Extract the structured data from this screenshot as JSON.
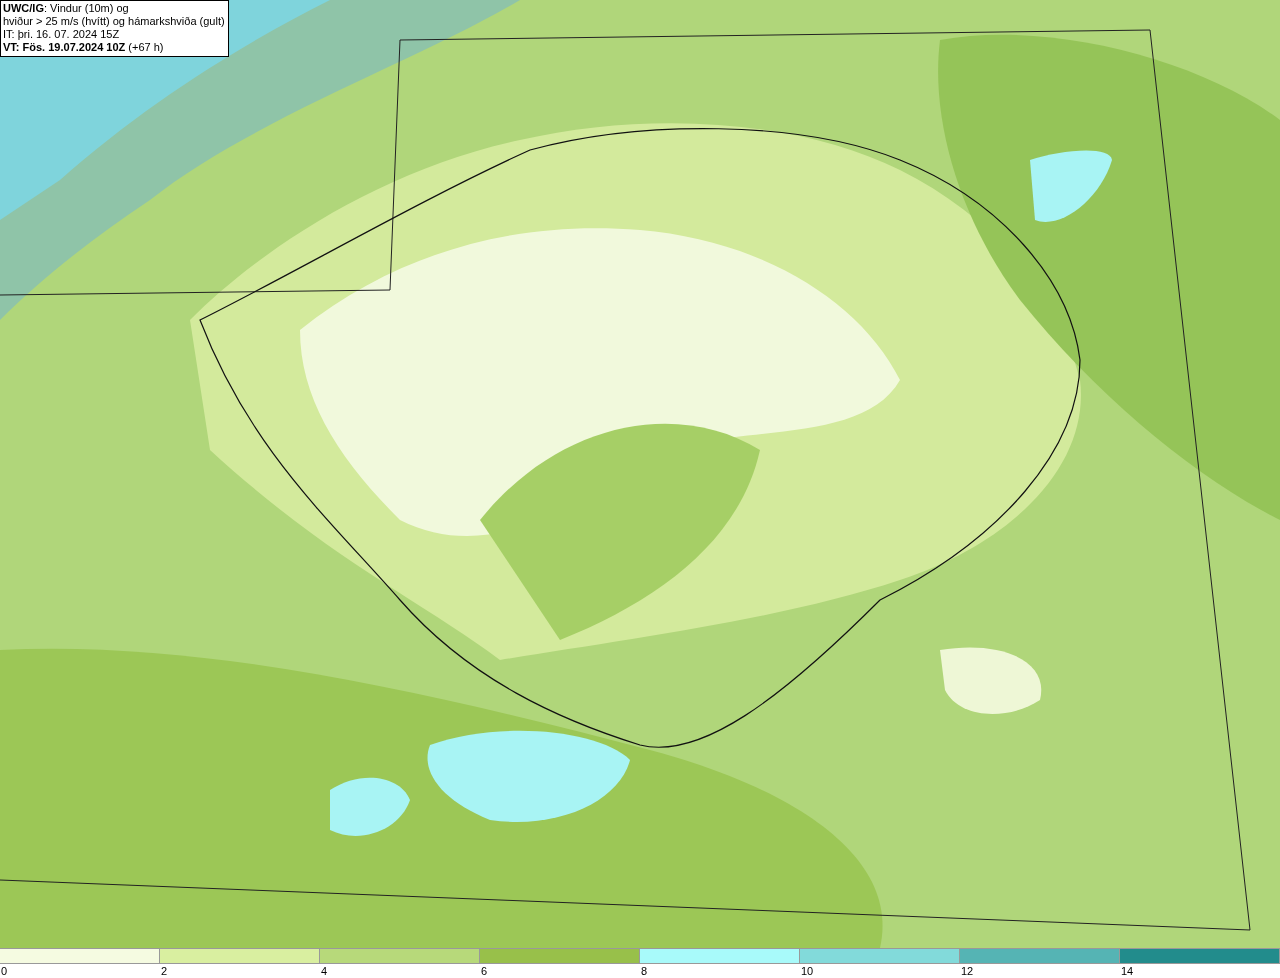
{
  "header": {
    "lines": [
      "**UWC/IG**: Vindur (10m) og",
      "hviður > 25 m/s (hvítt) og hámarkshviða (gult)",
      "IT: þri. 16. 07. 2024 15Z",
      "**VT: Fös. 19.07.2024 10Z** (+67 h)"
    ]
  },
  "legend": {
    "bins": [
      {
        "color": "#f5fbe1"
      },
      {
        "color": "#d9efa0"
      },
      {
        "color": "#b7d97a"
      },
      {
        "color": "#98c04a"
      },
      {
        "color": "#a8fafa"
      },
      {
        "color": "#82dada"
      },
      {
        "color": "#55b4b4"
      },
      {
        "color": "#228c8c"
      }
    ],
    "labels": [
      "0",
      "2",
      "4",
      "6",
      "8",
      "10",
      "12",
      "14"
    ]
  }
}
